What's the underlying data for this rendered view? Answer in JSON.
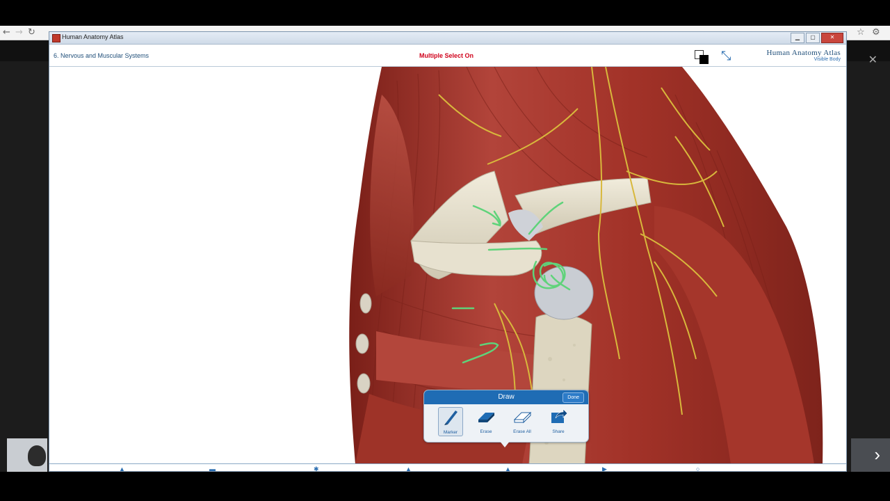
{
  "window": {
    "title": "Human Anatomy Atlas"
  },
  "header": {
    "section_title": "6. Nervous and Muscular Systems",
    "mode_label": "Multiple Select On",
    "brand_line1": "Human Anatomy Atlas",
    "brand_line2": "Visible Body"
  },
  "draw_panel": {
    "title": "Draw",
    "done_label": "Done",
    "tools": [
      {
        "label": "Marker",
        "icon": "marker-icon",
        "selected": true
      },
      {
        "label": "Erase",
        "icon": "eraser-icon",
        "selected": false
      },
      {
        "label": "Erase All",
        "icon": "erase-all-icon",
        "selected": false
      },
      {
        "label": "Share",
        "icon": "share-icon",
        "selected": false
      }
    ]
  },
  "colors": {
    "accent": "#1f6cb4",
    "mode_red": "#d0021b",
    "muscle": "#a8342a",
    "bone": "#e8e3d3",
    "nerve": "#d8b83c",
    "annotation": "#5fd37a"
  }
}
